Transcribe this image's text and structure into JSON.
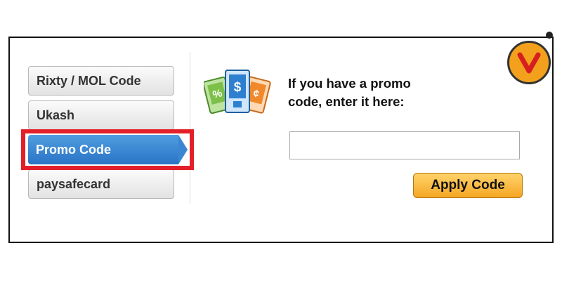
{
  "sidebar": {
    "items": [
      {
        "label": "Rixty / MOL Code",
        "active": false
      },
      {
        "label": "Ukash",
        "active": false
      },
      {
        "label": "Promo Code",
        "active": true
      },
      {
        "label": "paysafecard",
        "active": false
      }
    ]
  },
  "main": {
    "prompt_line1": "If you have a promo",
    "prompt_line2": "code, enter it here:",
    "code_input": {
      "value": "",
      "placeholder": ""
    },
    "apply_label": "Apply Code"
  },
  "icons": {
    "promo_cards": "coupon-cards-icon",
    "logo": "logo-badge-icon"
  },
  "colors": {
    "active_tab": "#3a86d3",
    "apply_button": "#f5a623",
    "highlight": "#e3202a",
    "logo": "#f3a11c"
  }
}
